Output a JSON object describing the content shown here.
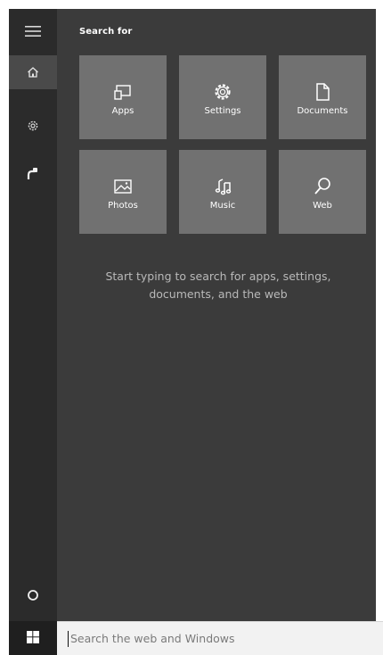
{
  "sidebar": {
    "items": [
      {
        "icon": "hamburger-menu-icon",
        "active": false
      },
      {
        "icon": "home-icon",
        "active": true
      },
      {
        "icon": "gear-icon",
        "active": false
      },
      {
        "icon": "feedback-icon",
        "active": false
      },
      {
        "icon": "cortana-circle-icon",
        "active": false
      }
    ]
  },
  "panel": {
    "heading": "Search for",
    "tiles": [
      {
        "label": "Apps",
        "icon": "apps-icon"
      },
      {
        "label": "Settings",
        "icon": "settings-gear-icon"
      },
      {
        "label": "Documents",
        "icon": "document-icon"
      },
      {
        "label": "Photos",
        "icon": "photo-icon"
      },
      {
        "label": "Music",
        "icon": "music-note-icon"
      },
      {
        "label": "Web",
        "icon": "web-search-icon"
      }
    ],
    "hint": "Start typing to search for apps, settings, documents, and the web"
  },
  "taskbar": {
    "start_icon": "windows-logo-icon",
    "search_placeholder": "Search the web and Windows",
    "search_value": ""
  },
  "colors": {
    "sidebar_bg": "#2b2b2b",
    "panel_bg": "#3b3b3b",
    "tile_bg": "#717171",
    "active_item_bg": "#4a4a4a",
    "search_bg": "#f2f2f2"
  }
}
